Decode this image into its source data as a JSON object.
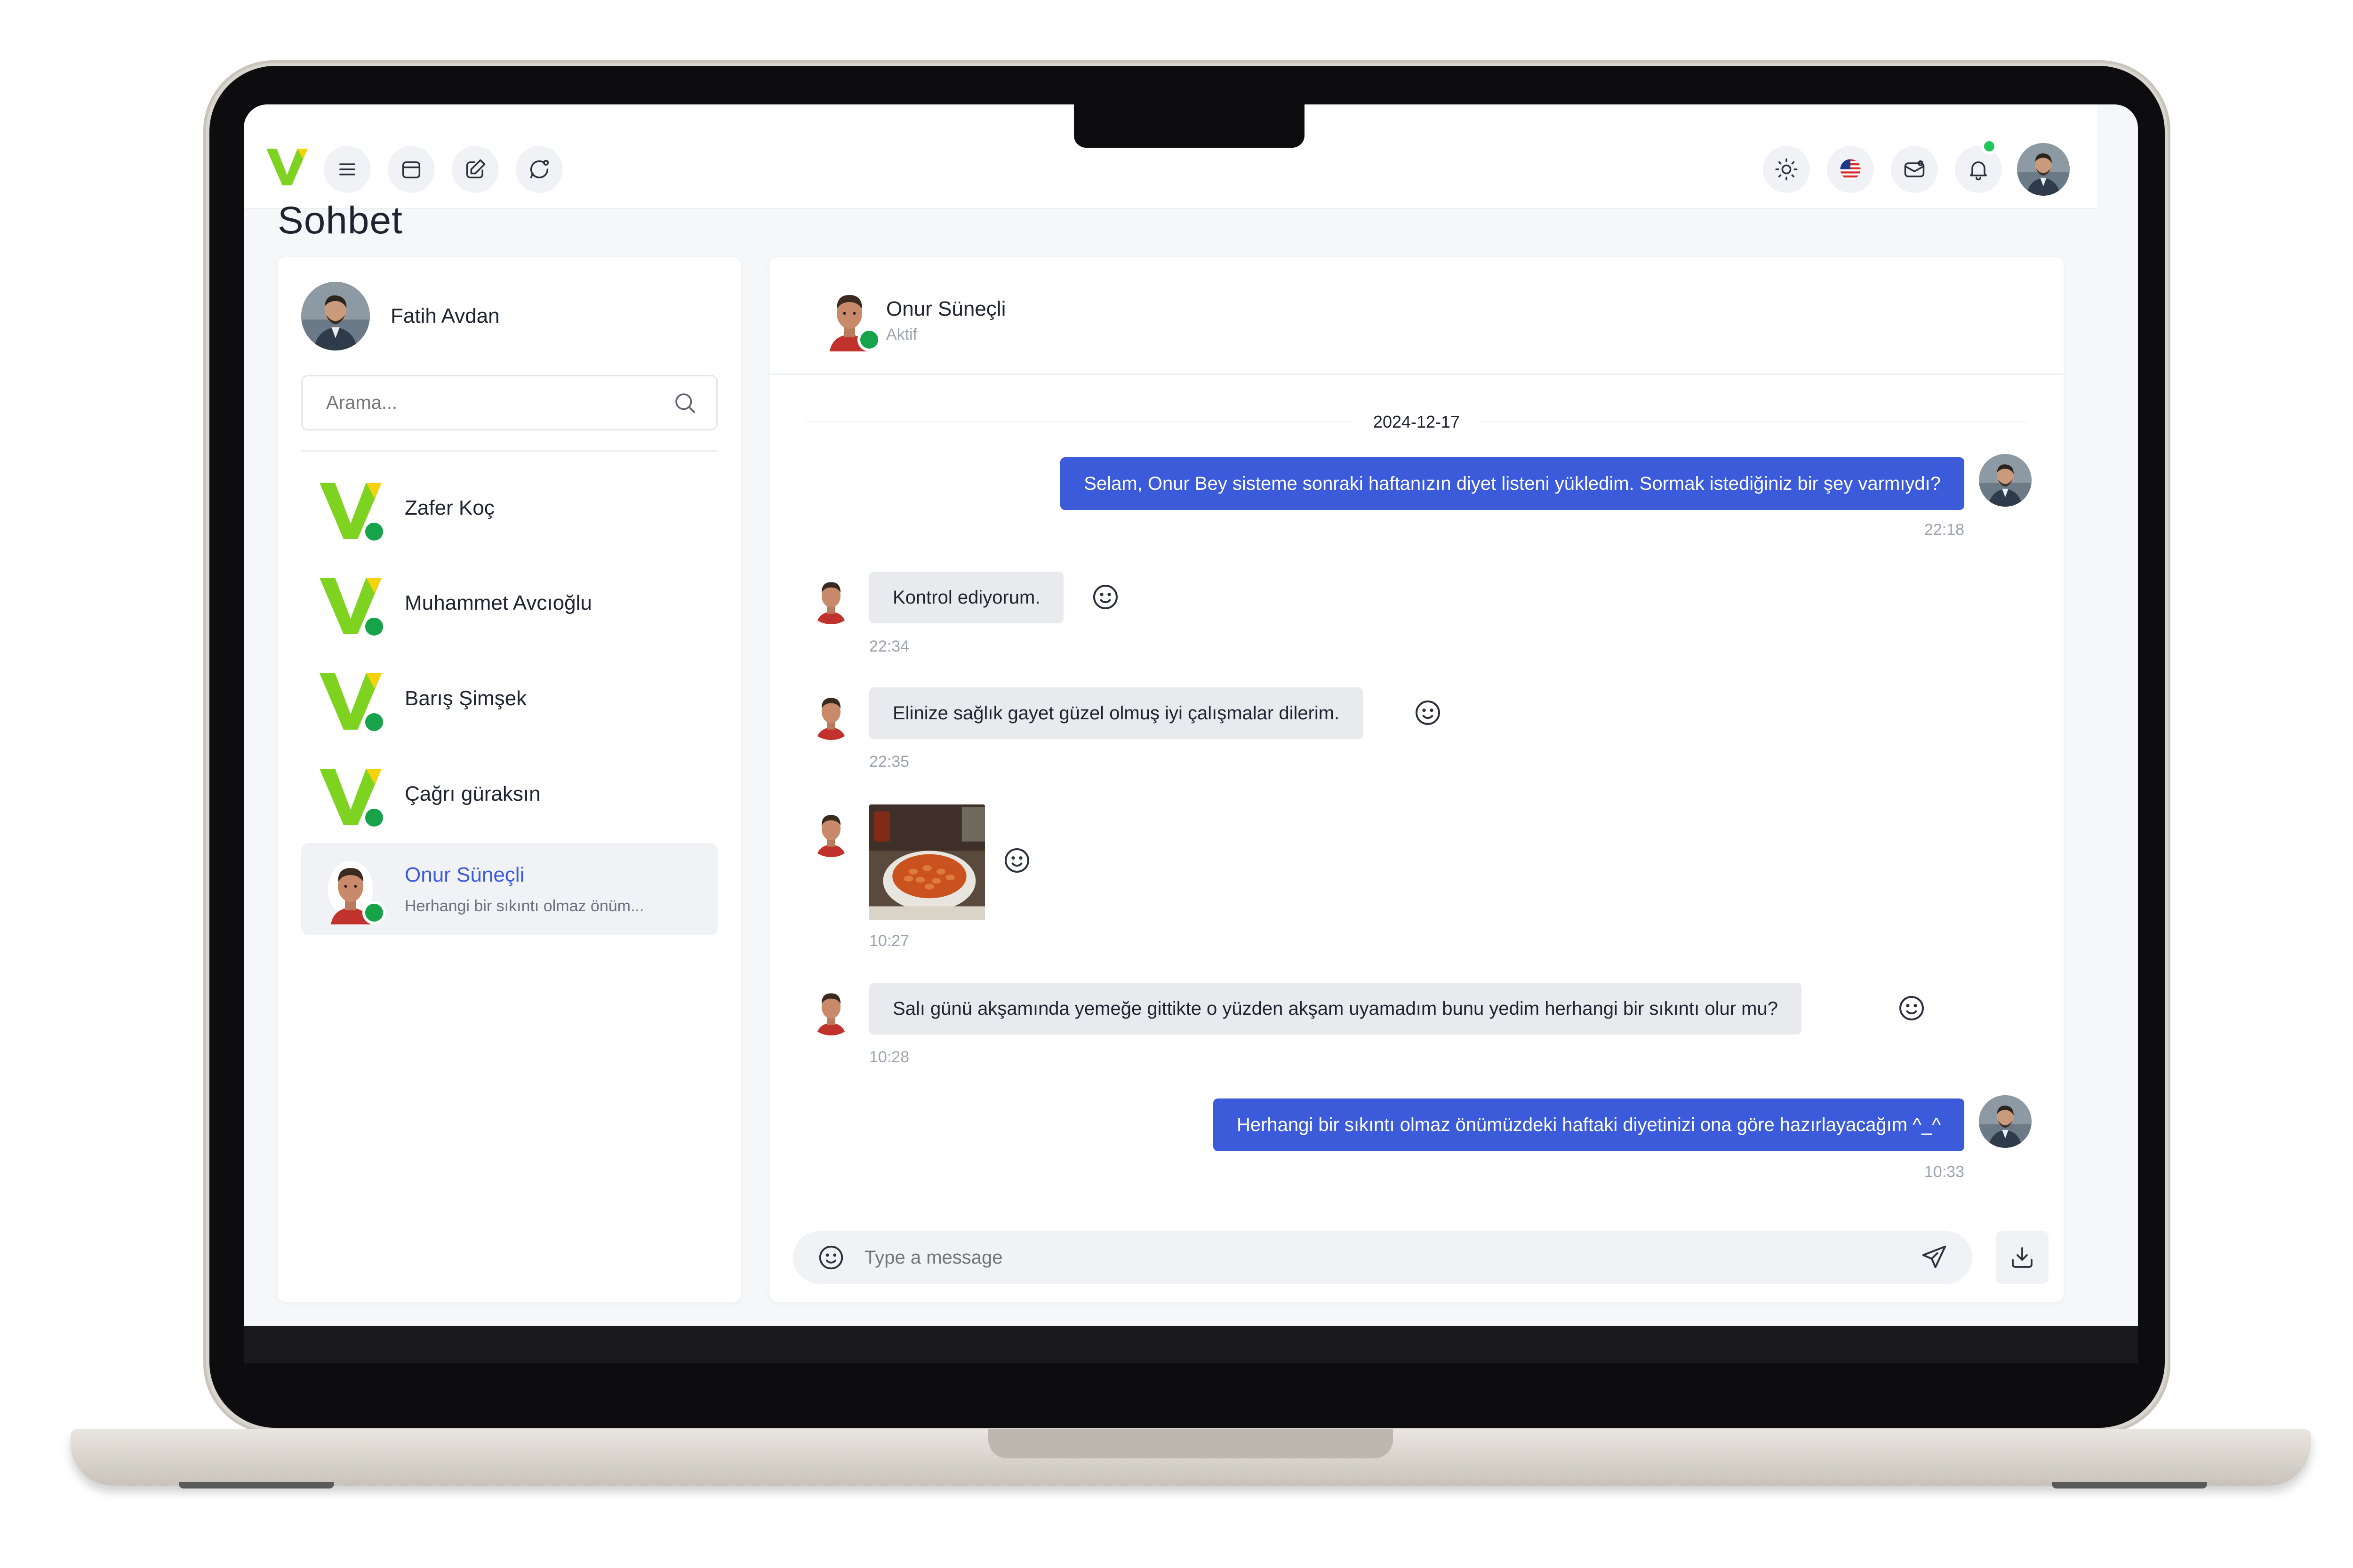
{
  "page": {
    "title": "Sohbet"
  },
  "topbar": {
    "icons": [
      "menu-icon",
      "calendar-icon",
      "edit-icon",
      "chat-icon",
      "sun-icon",
      "us-flag-icon",
      "mail-icon",
      "bell-icon"
    ],
    "notification_dot_color": "#22c55e"
  },
  "sidebar": {
    "me": {
      "name": "Fatih Avdan"
    },
    "search": {
      "placeholder": "Arama...",
      "value": ""
    },
    "contacts": [
      {
        "name": "Zafer Koç",
        "preview": "",
        "active": false
      },
      {
        "name": "Muhammet Avcıoğlu",
        "preview": "",
        "active": false
      },
      {
        "name": "Barış Şimşek",
        "preview": "",
        "active": false
      },
      {
        "name": "Çağrı güraksın",
        "preview": "",
        "active": false
      },
      {
        "name": "Onur Süneçli",
        "preview": "Herhangi bir sıkıntı olmaz önüm...",
        "active": true
      }
    ]
  },
  "chat": {
    "header": {
      "name": "Onur Süneçli",
      "status": "Aktif"
    },
    "date": "2024-12-17",
    "messages": [
      {
        "direction": "out",
        "text": "Selam, Onur Bey sisteme sonraki haftanızın diyet listeni yükledim. Sormak istediğiniz bir şey varmıydı?",
        "time": "22:18"
      },
      {
        "direction": "in",
        "text": "Kontrol ediyorum.",
        "time": "22:34"
      },
      {
        "direction": "in",
        "text": "Elinize sağlık gayet güzel olmuş iyi çalışmalar dilerim.",
        "time": "22:35"
      },
      {
        "direction": "in",
        "type": "image",
        "image": "bean-stew-photo",
        "time": "10:27"
      },
      {
        "direction": "in",
        "text": "Salı günü akşamında yemeğe gittikte o yüzden akşam uyamadım bunu yedim herhangi bir sıkıntı olur mu?",
        "time": "10:28"
      },
      {
        "direction": "out",
        "text": "Herhangi bir sıkıntı olmaz önümüzdeki haftaki diyetinizi ona göre hazırlayacağım ^_^",
        "time": "10:33"
      }
    ],
    "composer": {
      "placeholder": "Type a message",
      "value": ""
    }
  },
  "colors": {
    "accent": "#3b5bdb",
    "online": "#16a34a",
    "bubble_in": "#e9eaed",
    "logo_green": "#7ed321"
  }
}
